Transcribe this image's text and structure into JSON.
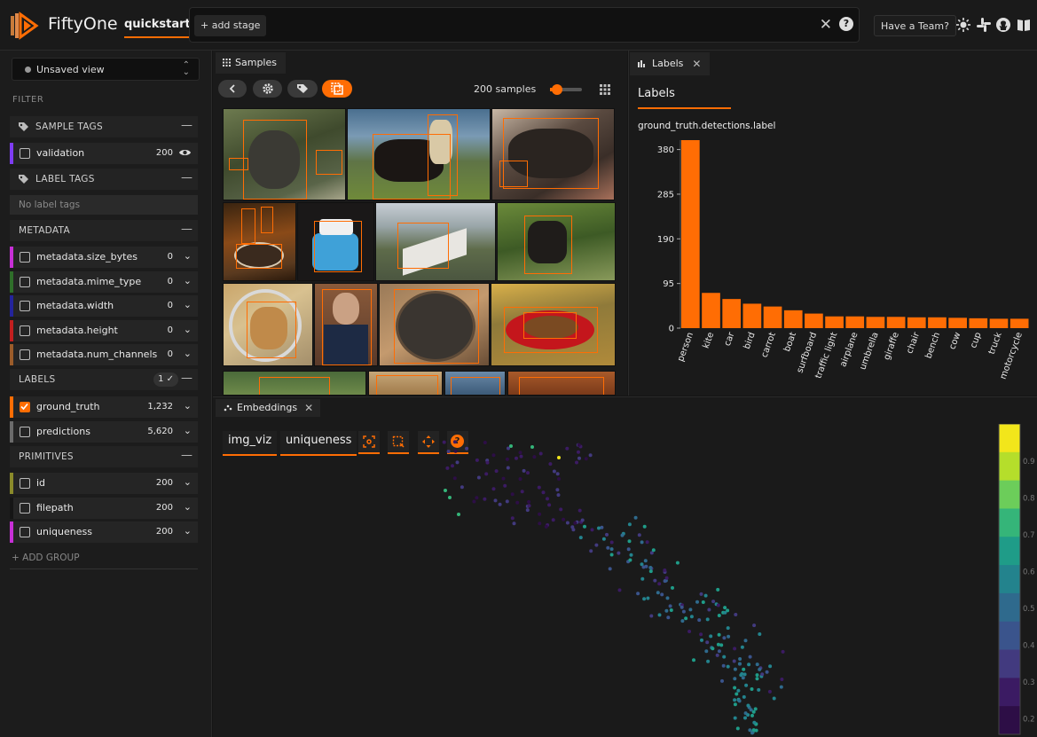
{
  "header": {
    "brand": "FiftyOne",
    "dataset": "quickstart",
    "add_stage": "+ add stage",
    "close_glyph": "✕",
    "help_glyph": "?",
    "team_button": "Have a Team?",
    "icons": [
      "sun-icon",
      "slack-icon",
      "github-icon",
      "book-icon"
    ]
  },
  "sidebar": {
    "view_selector": "Unsaved view",
    "filter_heading": "FILTER",
    "sample_tags": {
      "title": "SAMPLE TAGS",
      "items": [
        {
          "label": "validation",
          "count": "200",
          "color": "#7e3cf2"
        }
      ]
    },
    "label_tags": {
      "title": "LABEL TAGS",
      "empty": "No label tags"
    },
    "metadata": {
      "title": "METADATA",
      "items": [
        {
          "label": "metadata.size_bytes",
          "count": "0",
          "color": "#c72fd6"
        },
        {
          "label": "metadata.mime_type",
          "count": "0",
          "color": "#2f6e2a"
        },
        {
          "label": "metadata.width",
          "count": "0",
          "color": "#24249c"
        },
        {
          "label": "metadata.height",
          "count": "0",
          "color": "#c21f1f"
        },
        {
          "label": "metadata.num_channels",
          "count": "0",
          "color": "#9b5c2a"
        }
      ]
    },
    "labels": {
      "title": "LABELS",
      "badge": "1 ✓",
      "items": [
        {
          "label": "ground_truth",
          "count": "1,232",
          "color": "#ff6d04",
          "checked": true
        },
        {
          "label": "predictions",
          "count": "5,620",
          "color": "#6b6b6b",
          "checked": false
        }
      ]
    },
    "primitives": {
      "title": "PRIMITIVES",
      "items": [
        {
          "label": "id",
          "count": "200",
          "color": "#8a8a2a"
        },
        {
          "label": "filepath",
          "count": "200",
          "color": "#151515"
        },
        {
          "label": "uniqueness",
          "count": "200",
          "color": "#c72fd6"
        }
      ]
    },
    "add_group": "+ ADD GROUP",
    "collapse_glyph": "—",
    "dropdown_glyph": "⌄"
  },
  "samples_panel": {
    "tab": "Samples",
    "count": "200 samples",
    "zoom_level": 0.15,
    "tools": [
      "back-icon",
      "gear-icon",
      "tag-icon",
      "select-icon"
    ]
  },
  "labels_panel": {
    "tab": "Labels",
    "close_glyph": "✕",
    "heading": "Labels",
    "chart_title": "ground_truth.detections.label"
  },
  "chart_data": {
    "type": "bar",
    "title": "ground_truth.detections.label",
    "categories": [
      "person",
      "kite",
      "car",
      "bird",
      "carrot",
      "boat",
      "surfboard",
      "traffic light",
      "airplane",
      "umbrella",
      "giraffe",
      "chair",
      "bench",
      "cow",
      "cup",
      "truck",
      "motorcycle"
    ],
    "values": [
      400,
      75,
      62,
      52,
      46,
      38,
      31,
      25,
      25,
      24,
      24,
      23,
      23,
      22,
      21,
      20,
      20
    ],
    "yticks": [
      0,
      95,
      190,
      285,
      380
    ],
    "ylim": [
      0,
      400
    ],
    "color": "#ff6d04"
  },
  "embeddings_panel": {
    "tab": "Embeddings",
    "close_glyph": "✕",
    "brain_key": "img_viz",
    "color_by": "uniqueness",
    "tools": [
      "focus-icon",
      "lasso-icon",
      "pan-icon",
      "help-icon"
    ],
    "colorbar_ticks": [
      "0.9",
      "0.8",
      "0.7",
      "0.6",
      "0.5",
      "0.4",
      "0.3",
      "0.2"
    ]
  }
}
